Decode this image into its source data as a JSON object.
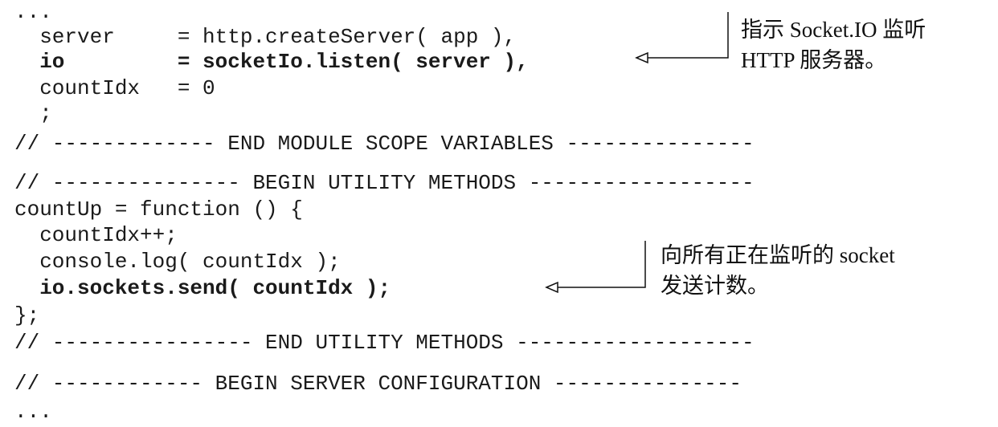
{
  "code_lines": [
    "...",
    "  server     = http.createServer( app ),",
    "  io         = socketIo.listen( server ),",
    "  countIdx   = 0",
    "  ;",
    "// ------------- END MODULE SCOPE VARIABLES ---------------",
    "// --------------- BEGIN UTILITY METHODS ------------------",
    "countUp = function () {",
    "  countIdx++;",
    "  console.log( countIdx );",
    "  io.sockets.send( countIdx );",
    "};",
    "// ---------------- END UTILITY METHODS -------------------",
    "// ------------ BEGIN SERVER CONFIGURATION ---------------",
    "..."
  ],
  "annotations": [
    {
      "line1": "指示 Socket.IO 监听",
      "line2": "HTTP 服务器。"
    },
    {
      "line1": "向所有正在监听的 socket",
      "line2": "发送计数。"
    }
  ]
}
